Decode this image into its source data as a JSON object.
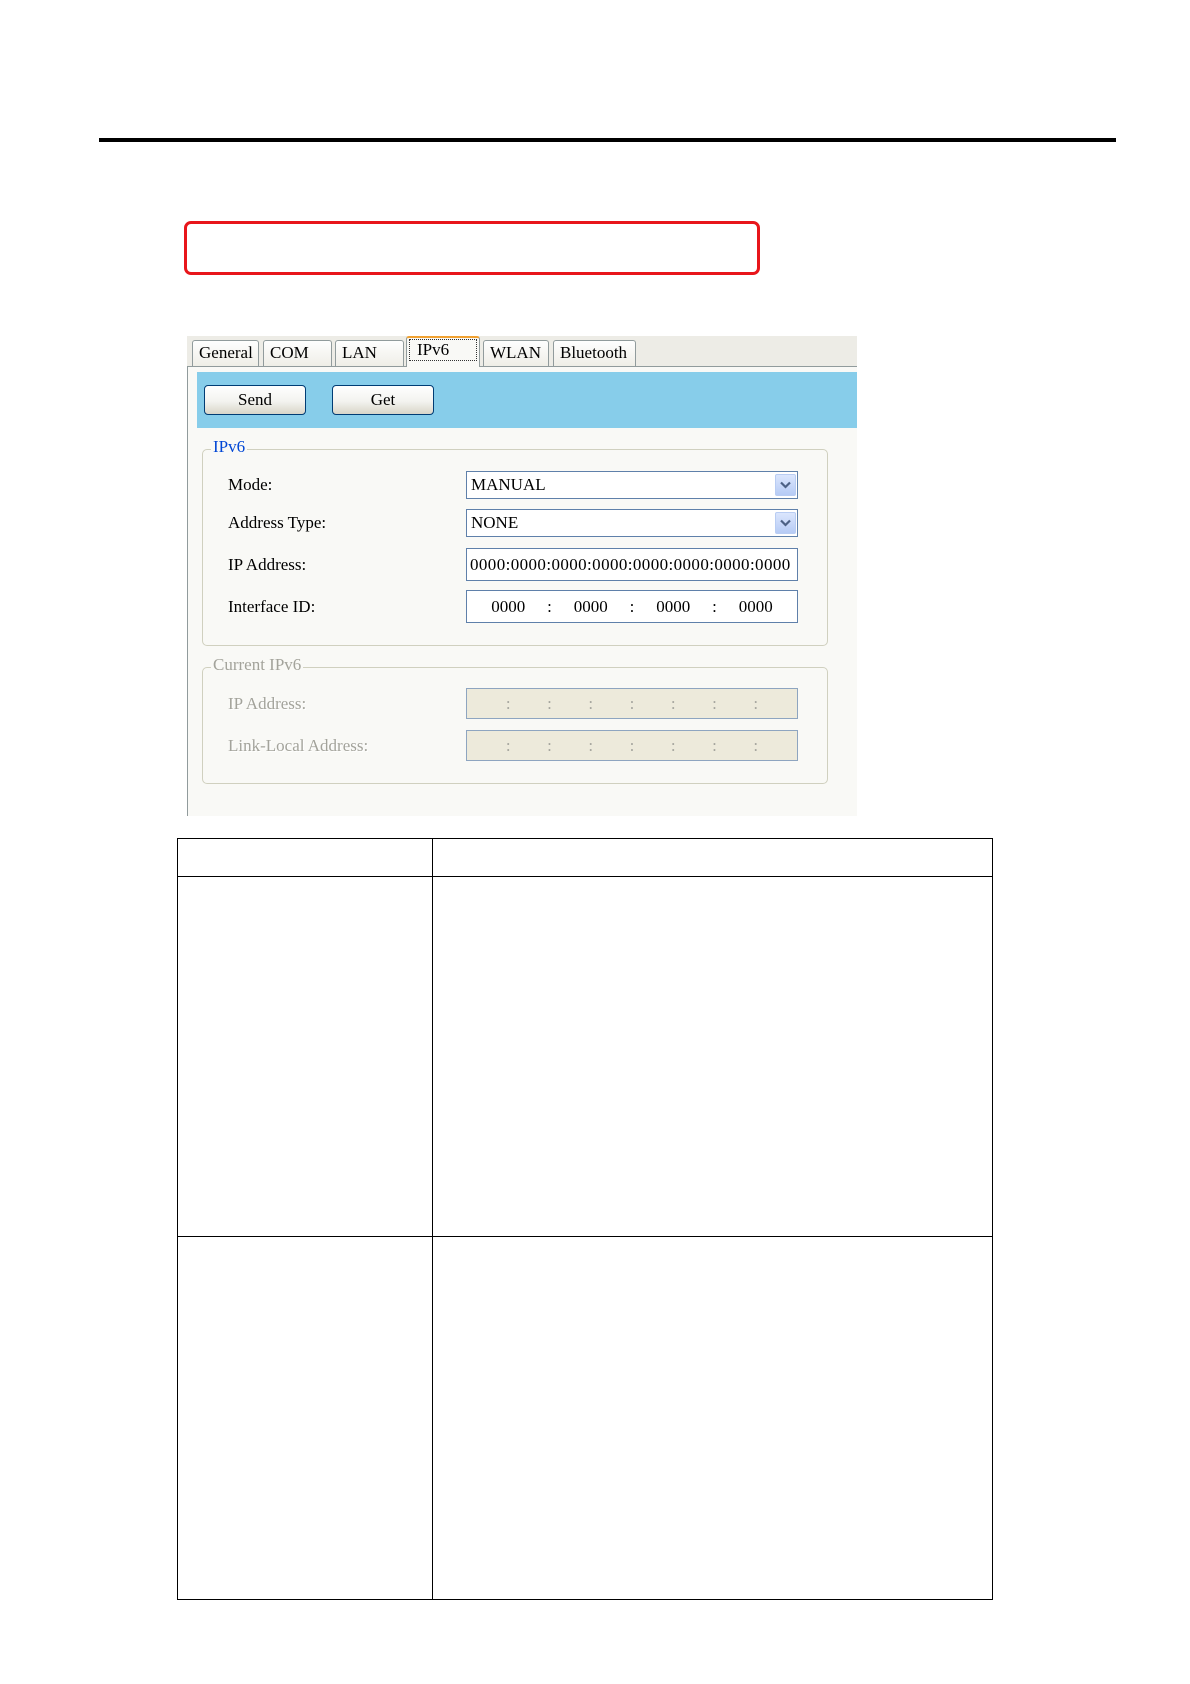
{
  "window": {
    "tabs": [
      {
        "label": "General",
        "selected": false
      },
      {
        "label": "COM",
        "selected": false
      },
      {
        "label": "LAN",
        "selected": false
      },
      {
        "label": "IPv6",
        "selected": true
      },
      {
        "label": "WLAN",
        "selected": false
      },
      {
        "label": "Bluetooth",
        "selected": false
      }
    ],
    "toolbar": {
      "send_label": "Send",
      "get_label": "Get"
    },
    "ipv6_group": {
      "legend": "IPv6",
      "enabled": true,
      "mode": {
        "label": "Mode:",
        "value": "MANUAL",
        "icon": "chevron-down-icon"
      },
      "address_type": {
        "label": "Address Type:",
        "value": "NONE",
        "icon": "chevron-down-icon"
      },
      "ip_address": {
        "label": "IP Address:",
        "value": "0000:0000:0000:0000:0000:0000:0000:0000"
      },
      "interface_id": {
        "label": "Interface ID:",
        "separator": ":",
        "segments": [
          "0000",
          "0000",
          "0000",
          "0000"
        ]
      }
    },
    "current_group": {
      "legend": "Current IPv6",
      "enabled": false,
      "ip_address": {
        "label": "IP Address:",
        "separator": ":",
        "segments": [
          "",
          "",
          "",
          "",
          "",
          "",
          "",
          ""
        ]
      },
      "link_local_address": {
        "label": "Link-Local Address:",
        "separator": ":",
        "segments": [
          "",
          "",
          "",
          "",
          "",
          "",
          "",
          ""
        ]
      }
    }
  },
  "colors": {
    "toolbar": "#87cdea",
    "group_legend": "#0046d5",
    "callout_border": "#e8161b"
  }
}
